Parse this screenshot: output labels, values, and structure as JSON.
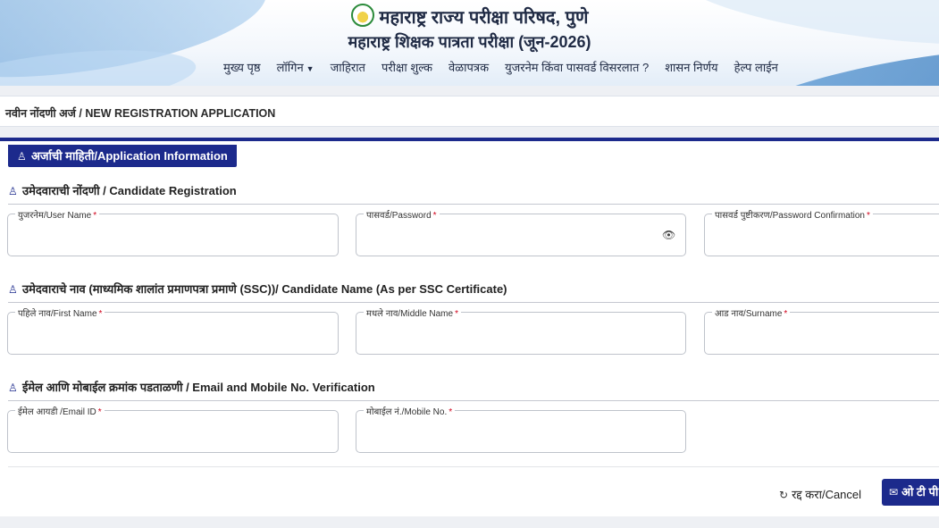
{
  "header": {
    "org_name": "महाराष्ट्र राज्य परीक्षा परिषद, पुणे",
    "subtitle": "महाराष्ट्र शिक्षक पात्रता परीक्षा (जून-2026)",
    "logo_icon": "emblem-icon",
    "nav": [
      "मुख्य पृष्ठ",
      "लॉगिन",
      "जाहिरात",
      "परीक्षा शुल्क",
      "वेळापत्रक",
      "युजरनेम किंवा पासवर्ड विसरलात ?",
      "शासन निर्णय",
      "हेल्प लाईन"
    ]
  },
  "breadcrumb": "नवीन नोंदणी अर्ज / NEW REGISTRATION APPLICATION",
  "form": {
    "tab_label": "अर्जाची माहिती/Application Information",
    "sections": {
      "registration": "उमेदवाराची नोंदणी / Candidate Registration",
      "name": "उमेदवाराचे नाव (माध्यमिक शालांत प्रमाणपत्रा प्रमाणे (SSC))/ Candidate Name (As per SSC Certificate)",
      "contact": "ईमेल आणि मोबाईल क्रमांक पडताळणी / Email and Mobile No. Verification"
    },
    "fields": {
      "username": {
        "label": "युजरनेम/User Name",
        "value": ""
      },
      "password": {
        "label": "पासवर्ड/Password",
        "value": ""
      },
      "password_confirm": {
        "label": "पासवर्ड पुष्टीकरण/Password Confirmation",
        "value": ""
      },
      "first_name": {
        "label": "पहिले नाव/First Name",
        "value": ""
      },
      "middle_name": {
        "label": "मधले नाव/Middle Name",
        "value": ""
      },
      "surname": {
        "label": "आड नाव/Surname",
        "value": ""
      },
      "email": {
        "label": "ईमेल आयडी /Email ID",
        "value": ""
      },
      "mobile": {
        "label": "मोबाईल नं./Mobile No.",
        "value": ""
      }
    },
    "required_mark": "*",
    "cancel_label": "रद्द करा/Cancel",
    "otp_label": "ओ टी पी"
  },
  "colors": {
    "primary": "#1c2a8c",
    "required": "#d0021b"
  }
}
